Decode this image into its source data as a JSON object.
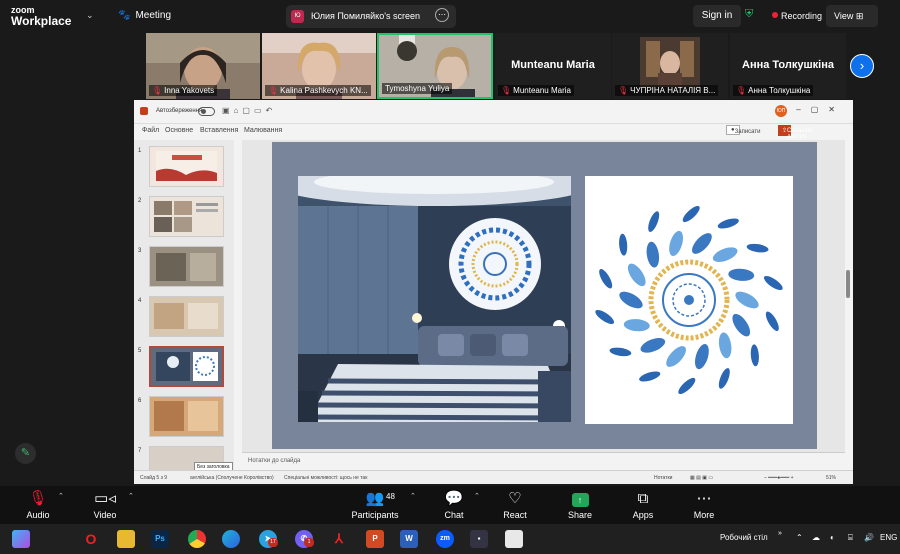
{
  "app": {
    "logo_line1": "zoom",
    "logo_line2": "Workplace"
  },
  "meeting": {
    "label": "Meeting"
  },
  "share_pill": {
    "avatar": "Ю",
    "text": "Юлия Помиляйко's screen",
    "more_icon": "⋯"
  },
  "header_right": {
    "sign_in": "Sign in",
    "recording": "Recording",
    "view": "View",
    "shield_icon": "shield-check-icon"
  },
  "participants_strip": [
    {
      "name": "Inna Yakovets",
      "muted": true,
      "video": true,
      "color": "#8b7b6a"
    },
    {
      "name": "Kalina Pashkevych KN...",
      "muted": true,
      "video": true,
      "color": "#c9a998"
    },
    {
      "name": "Tymoshyna Yuliya",
      "muted": false,
      "video": true,
      "active": true,
      "color": "#b6b0a7"
    },
    {
      "name": "Munteanu Maria",
      "big": "Munteanu Maria",
      "muted": true,
      "video": false,
      "color": "#202020"
    },
    {
      "name": "ЧУПРІНА НАТАЛІЯ В...",
      "muted": true,
      "video": true,
      "color": "#4a3a30"
    },
    {
      "name": "Анна Толкушкіна",
      "big": "Анна Толкушкіна",
      "muted": true,
      "video": false,
      "color": "#202020"
    }
  ],
  "powerpoint": {
    "autosave": "Автозбереження",
    "tabs": [
      "Файл",
      "Основне",
      "Вставлення",
      "Малювання"
    ],
    "avatar": "ЮП",
    "save_button": "Записати",
    "share_button": "Спільний доступ",
    "slides": [
      {
        "number": "1",
        "color": "#e8d8cc"
      },
      {
        "number": "2",
        "color": "#d9cfc4"
      },
      {
        "number": "3",
        "color": "#9a9182"
      },
      {
        "number": "4",
        "color": "#d8c8b2"
      },
      {
        "number": "5",
        "color": "#4f6784",
        "selected": true
      },
      {
        "number": "6",
        "color": "#d7a877"
      },
      {
        "number": "7",
        "color": "#d8d0c6"
      }
    ],
    "tooltip": "Без заголовка",
    "notes_placeholder": "Нотатки до слайда",
    "status": {
      "slide": "Слайд 5 з 9",
      "language": "англійська (Сполучене Королівство)",
      "accessibility": "Спеціальні можливості: щось не так",
      "notes": "Нотатки",
      "zoom": "51%"
    }
  },
  "controls": {
    "audio": "Audio",
    "video": "Video",
    "participants": "Participants",
    "participant_count": "48",
    "chat": "Chat",
    "react": "React",
    "share": "Share",
    "apps": "Apps",
    "more": "More"
  },
  "taskbar": {
    "desktop_label": "Робочий стіл",
    "language": "ENG",
    "apps": [
      "copilot",
      "opera",
      "files",
      "photoshop",
      "chrome",
      "edge",
      "telegram",
      "viber",
      "acrobat",
      "powerpoint",
      "word",
      "zoom",
      "save",
      "terminal"
    ],
    "badges": {
      "telegram": "17",
      "viber": "1"
    }
  }
}
